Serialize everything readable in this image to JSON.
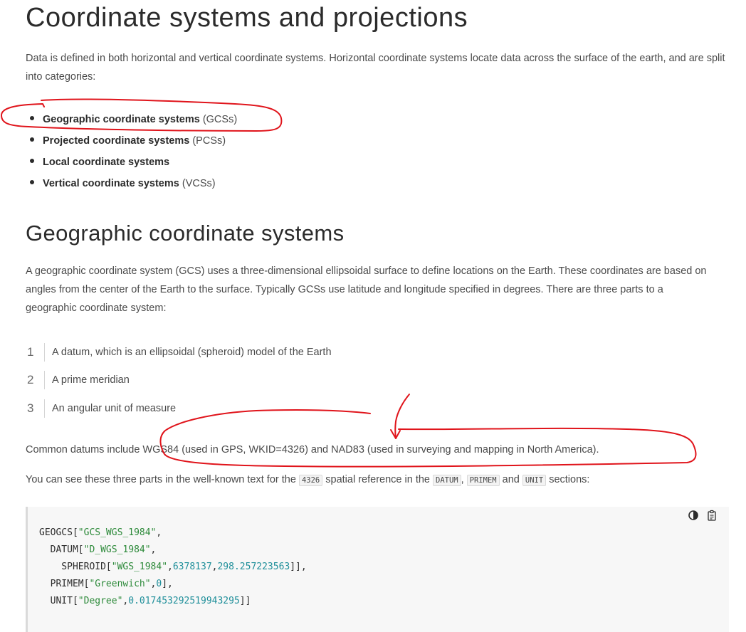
{
  "heading": "Coordinate systems and projections",
  "intro": "Data is defined in both horizontal and vertical coordinate systems. Horizontal coordinate systems locate data across the surface of the earth, and are split into categories:",
  "categories": [
    {
      "name": "Geographic coordinate systems",
      "abbr": "(GCSs)"
    },
    {
      "name": "Projected coordinate systems",
      "abbr": "(PCSs)"
    },
    {
      "name": "Local coordinate systems",
      "abbr": ""
    },
    {
      "name": "Vertical coordinate systems",
      "abbr": "(VCSs)"
    }
  ],
  "gcs": {
    "heading": "Geographic coordinate systems",
    "description": "A geographic coordinate system (GCS) uses a three-dimensional ellipsoidal surface to define locations on the Earth. These coordinates are based on angles from the center of the Earth to the surface. Typically GCSs use latitude and longitude specified in degrees. There are three parts to a geographic coordinate system:",
    "parts": [
      {
        "num": "1",
        "text": "A datum, which is an ellipsoidal (spheroid) model of the Earth"
      },
      {
        "num": "2",
        "text": "A prime meridian"
      },
      {
        "num": "3",
        "text": "An angular unit of measure"
      }
    ],
    "datums": "Common datums include WGS84 (used in GPS, WKID=4326) and NAD83 (used in surveying and mapping in North America).",
    "wkt_intro": {
      "a": "You can see these three parts in the well-known text for the ",
      "code1": "4326",
      "b": " spatial reference in the ",
      "code2": "DATUM",
      "c": ", ",
      "code3": "PRIMEM",
      "d": " and ",
      "code4": "UNIT",
      "e": " sections:"
    }
  },
  "code": {
    "l1_a": "GEOGCS[",
    "l1_s": "\"GCS_WGS_1984\"",
    "l1_b": ",",
    "l2_a": "  DATUM[",
    "l2_s": "\"D_WGS_1984\"",
    "l2_b": ",",
    "l3_a": "    SPHEROID[",
    "l3_s": "\"WGS_1984\"",
    "l3_c1": ",",
    "l3_n1": "6378137",
    "l3_c2": ",",
    "l3_n2": "298.257223563",
    "l3_b": "]],",
    "l4_a": "  PRIMEM[",
    "l4_s": "\"Greenwich\"",
    "l4_c": ",",
    "l4_n": "0",
    "l4_b": "],",
    "l5_a": "  UNIT[",
    "l5_s": "\"Degree\"",
    "l5_c": ",",
    "l5_n": "0.017453292519943295",
    "l5_b": "]]"
  },
  "icons": {
    "theme_toggle": "contrast-icon",
    "copy": "clipboard-copy-icon"
  },
  "annotation_color": "#e0141b"
}
